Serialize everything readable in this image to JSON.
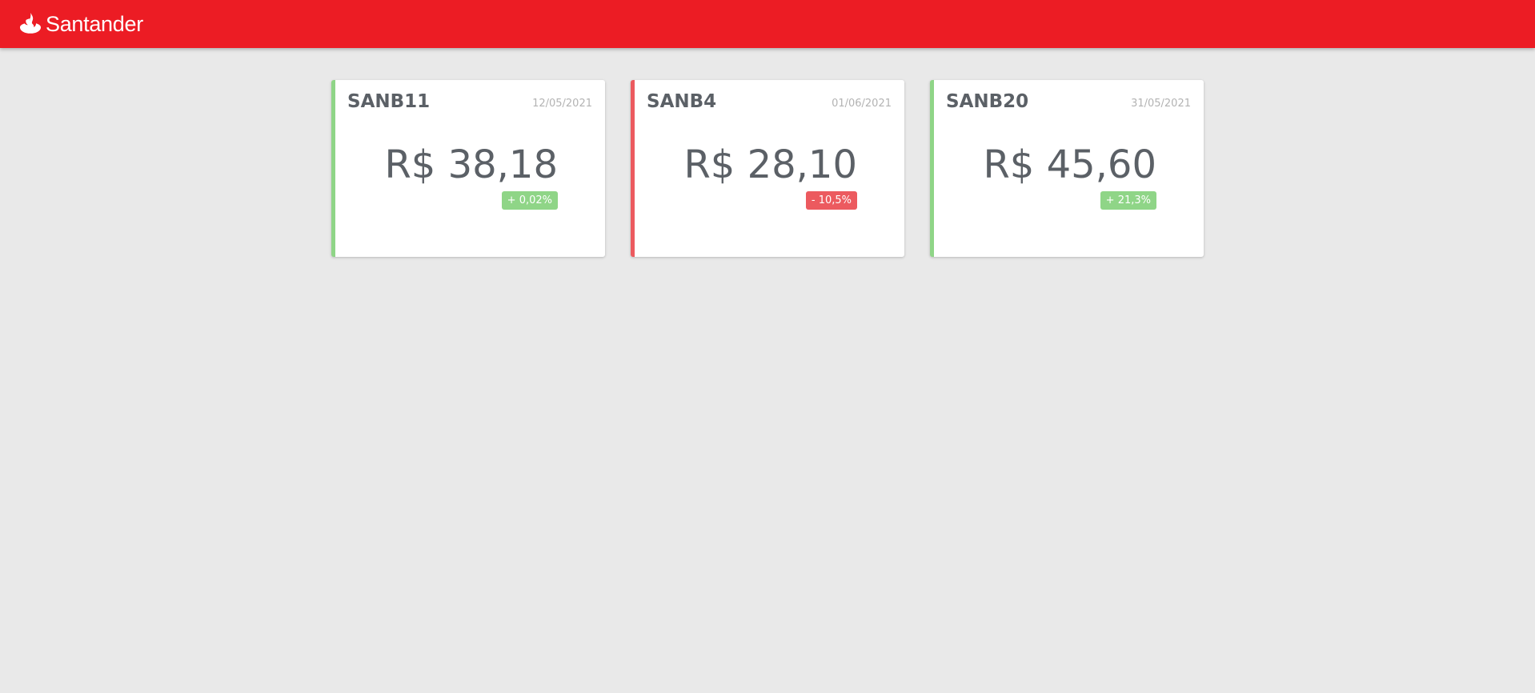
{
  "header": {
    "brand_name": "Santander",
    "brand_color": "#ec1c24",
    "logo_icon": "santander-flame-icon"
  },
  "colors": {
    "background": "#e9e9e9",
    "positive": "#8fd587",
    "negative": "#ec5a5f",
    "text": "#5b6066",
    "muted": "#b3b3b3"
  },
  "cards": [
    {
      "ticker": "SANB11",
      "date": "12/05/2021",
      "price": "R$ 38,18",
      "change": "+ 0,02%",
      "trend": "up"
    },
    {
      "ticker": "SANB4",
      "date": "01/06/2021",
      "price": "R$ 28,10",
      "change": "- 10,5%",
      "trend": "down"
    },
    {
      "ticker": "SANB20",
      "date": "31/05/2021",
      "price": "R$ 45,60",
      "change": "+ 21,3%",
      "trend": "up"
    }
  ]
}
